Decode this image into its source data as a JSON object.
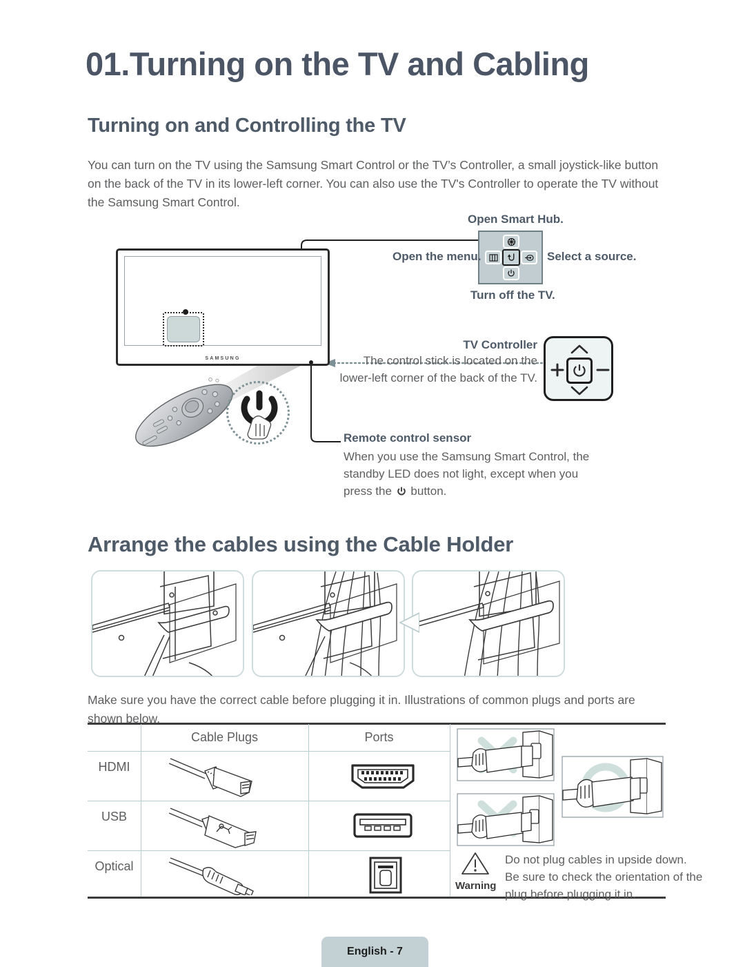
{
  "document": {
    "chapter_title": "01.Turning on the TV and Cabling",
    "page_footer": "English - 7"
  },
  "section1": {
    "heading": "Turning on and Controlling the TV",
    "intro": "You can turn on the TV using the Samsung Smart Control or the TV’s Controller, a small joystick-like button on the back of the TV in its lower-left corner. You can also use the TV's Controller to operate the TV without the Samsung Smart Control.",
    "tv_logo": "SAMSUNG",
    "dpad_callouts": {
      "top": "Open Smart Hub.",
      "left": "Open the menu.",
      "right": "Select a source.",
      "bottom": "Turn off the TV."
    },
    "dpad_icons": {
      "top": "smart-hub-icon",
      "left": "menu-icon",
      "center": "return-icon",
      "right": "source-icon",
      "bottom": "power-icon"
    },
    "tv_controller": {
      "title": "TV Controller",
      "body": "The control stick is located on the lower-left corner of the back of the TV.",
      "icons": [
        "chevron-up-icon",
        "plus-icon",
        "power-icon",
        "minus-icon",
        "chevron-down-icon"
      ]
    },
    "remote_sensor": {
      "title": "Remote control sensor",
      "body_line1": "When you use the Samsung Smart Control, the",
      "body_line2": "standby LED does not light, except when you",
      "body_line3_pre": "press the",
      "body_line3_post": "button."
    }
  },
  "section2": {
    "heading": "Arrange the cables using the Cable Holder",
    "panels": [
      "cable-holder-step-1",
      "cable-holder-step-2",
      "cable-holder-step-3"
    ],
    "cable_intro": "Make sure you have the correct cable before plugging it in. Illustrations of common plugs and ports are shown below.",
    "table": {
      "headers": [
        "",
        "Cable Plugs",
        "Ports"
      ],
      "rows": [
        {
          "label": "HDMI",
          "plug": "hdmi-plug-illustration",
          "port": "hdmi-port-illustration"
        },
        {
          "label": "USB",
          "plug": "usb-plug-illustration",
          "port": "usb-port-illustration"
        },
        {
          "label": "Optical",
          "plug": "optical-plug-illustration",
          "port": "optical-port-illustration"
        }
      ]
    },
    "orientation_panels": [
      {
        "mark": "x-mark",
        "name": "wrong-orientation-1"
      },
      {
        "mark": "x-mark",
        "name": "wrong-orientation-2"
      },
      {
        "mark": "o-mark",
        "name": "correct-orientation"
      }
    ],
    "warning": {
      "label": "Warning",
      "line1": "Do not plug cables in upside down.",
      "line2": "Be sure to check the orientation of the",
      "line3": "plug before plugging it in."
    }
  },
  "colors": {
    "heading": "#4e5a68",
    "body_text": "#5d5e60",
    "panel_border": "#cfdcdd",
    "dpad_bg": "#c2cdd2",
    "footer_badge": "#c3d1d4",
    "table_rule": "#3b3b3b",
    "table_grid": "#b9cccd"
  }
}
